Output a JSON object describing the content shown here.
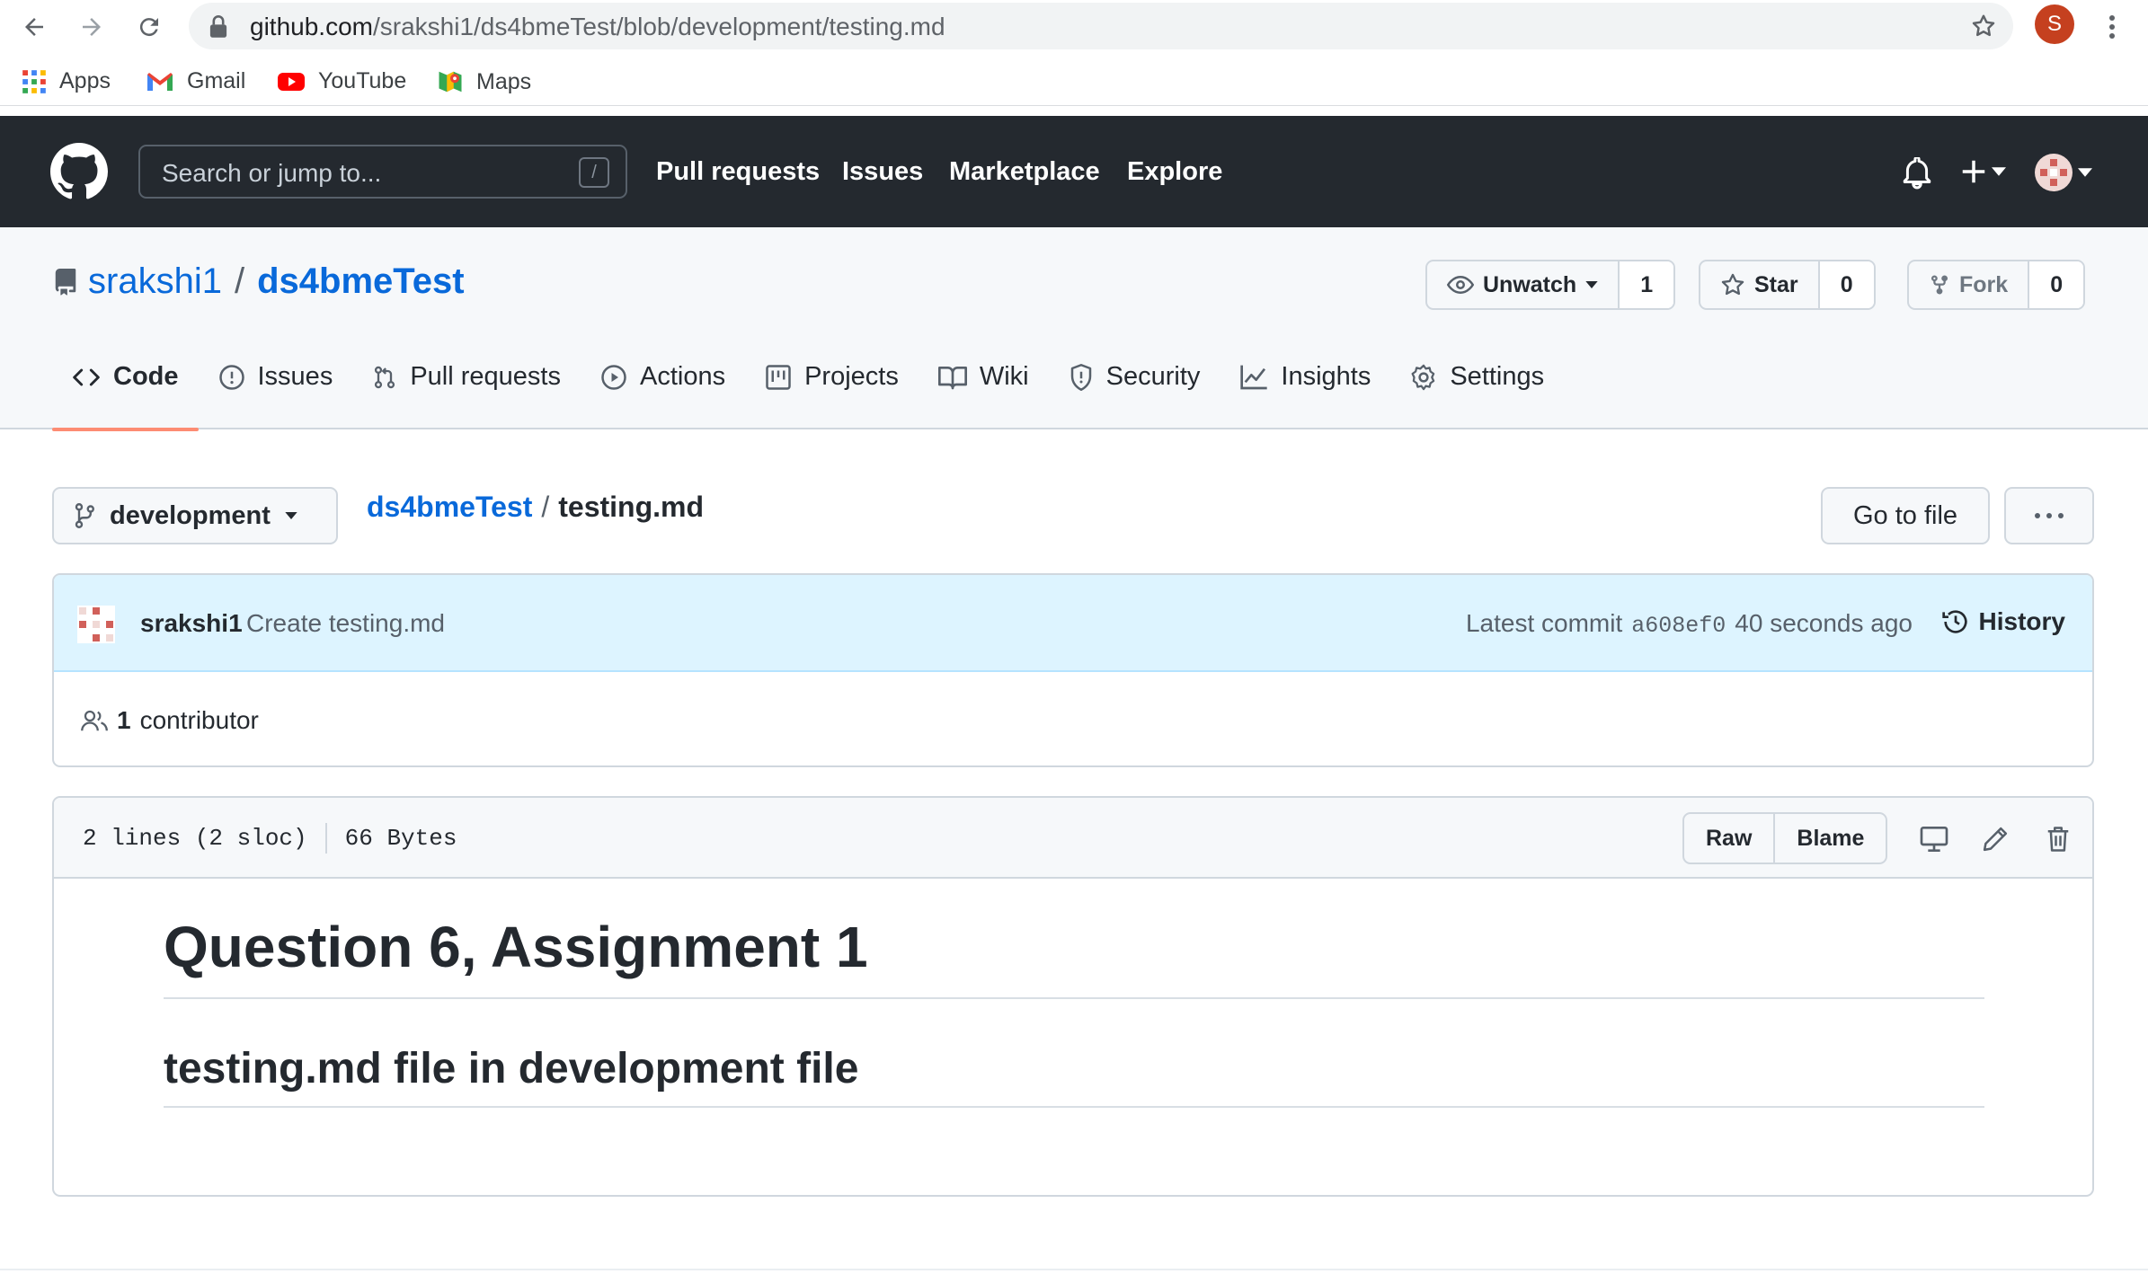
{
  "browser": {
    "url_host": "github.com",
    "url_path": "/srakshi1/ds4bmeTest/blob/development/testing.md",
    "profile_initial": "S",
    "bookmarks": [
      {
        "label": "Apps",
        "icon": "apps-grid-icon"
      },
      {
        "label": "Gmail",
        "icon": "gmail-icon"
      },
      {
        "label": "YouTube",
        "icon": "youtube-icon"
      },
      {
        "label": "Maps",
        "icon": "maps-icon"
      }
    ]
  },
  "header": {
    "search_placeholder": "Search or jump to...",
    "search_shortcut": "/",
    "nav": [
      "Pull requests",
      "Issues",
      "Marketplace",
      "Explore"
    ]
  },
  "repo": {
    "owner": "srakshi1",
    "separator": "/",
    "name": "ds4bmeTest",
    "unwatch_label": "Unwatch",
    "watch_count": "1",
    "star_label": "Star",
    "star_count": "0",
    "fork_label": "Fork",
    "fork_count": "0",
    "tabs": [
      {
        "label": "Code",
        "icon": "code-icon",
        "active": true
      },
      {
        "label": "Issues",
        "icon": "issue-icon"
      },
      {
        "label": "Pull requests",
        "icon": "pull-request-icon"
      },
      {
        "label": "Actions",
        "icon": "play-icon"
      },
      {
        "label": "Projects",
        "icon": "project-icon"
      },
      {
        "label": "Wiki",
        "icon": "book-icon"
      },
      {
        "label": "Security",
        "icon": "shield-icon"
      },
      {
        "label": "Insights",
        "icon": "graph-icon"
      },
      {
        "label": "Settings",
        "icon": "gear-icon"
      }
    ]
  },
  "file_nav": {
    "branch": "development",
    "breadcrumb_repo": "ds4bmeTest",
    "breadcrumb_sep": "/",
    "breadcrumb_file": "testing.md",
    "goto_file": "Go to file"
  },
  "commit": {
    "author": "srakshi1",
    "message": "Create testing.md",
    "latest_label": "Latest commit",
    "sha": "a608ef0",
    "time": "40 seconds ago",
    "history_label": "History",
    "contributor_count": "1",
    "contributor_label": "contributor"
  },
  "file": {
    "lines": "2 lines (2 sloc)",
    "size": "66 Bytes",
    "raw_label": "Raw",
    "blame_label": "Blame",
    "h1": "Question 6, Assignment 1",
    "h2": "testing.md file in development file"
  }
}
